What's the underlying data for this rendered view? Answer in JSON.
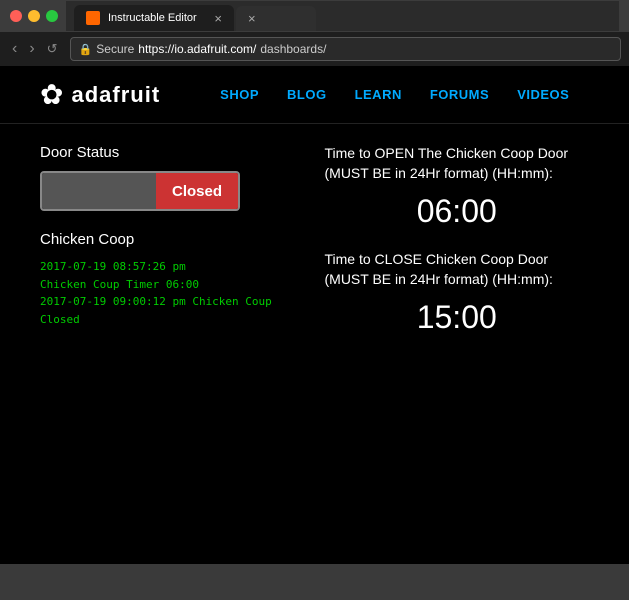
{
  "browser": {
    "traffic_lights": [
      "red",
      "yellow",
      "green"
    ],
    "tab_active": {
      "favicon_color": "#ff6600",
      "title": "Instructable Editor",
      "close": "×"
    },
    "tab_inactive": {
      "close": "×"
    },
    "nav": {
      "back": "‹",
      "forward": "›",
      "reload": "↺"
    },
    "url": {
      "lock": "🔒",
      "secure": "Secure",
      "full": "https://io.adafruit.com/",
      "path": "dashboards/"
    }
  },
  "site": {
    "logo": {
      "flower": "✿",
      "text": "adafruit"
    },
    "nav": [
      {
        "label": "SHOP"
      },
      {
        "label": "BLOG"
      },
      {
        "label": "LEARN"
      },
      {
        "label": "FORUMS"
      },
      {
        "label": "VIDEOS"
      }
    ],
    "door_status": {
      "title": "Door Status",
      "open_placeholder": "",
      "closed_label": "Closed"
    },
    "chicken_coop": {
      "title": "Chicken Coop",
      "logs": [
        "2017-07-19 08:57:26 pm",
        "Chicken Coup Timer 06:00",
        "2017-07-19 09:00:12 pm Chicken Coup",
        "Closed"
      ]
    },
    "open_time": {
      "label": "Time to OPEN The Chicken Coop Door (MUST BE in 24Hr format) (HH:mm):",
      "value": "06:00"
    },
    "close_time": {
      "label": "Time to CLOSE Chicken Coop Door (MUST BE in 24Hr format) (HH:mm):",
      "value": "15:00"
    }
  }
}
